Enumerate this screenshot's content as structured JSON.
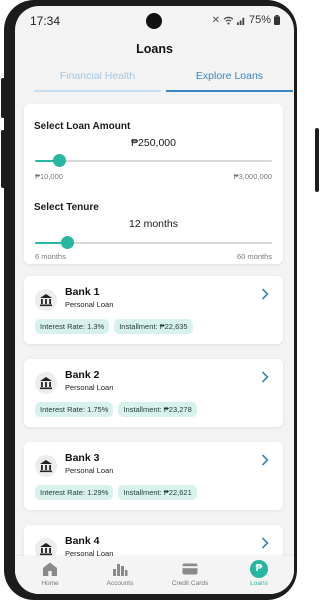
{
  "status_bar": {
    "time": "17:34",
    "battery": "75%"
  },
  "header": {
    "title": "Loans"
  },
  "tabs": [
    {
      "label": "Financial Health",
      "active": false
    },
    {
      "label": "Explore Loans",
      "active": true
    }
  ],
  "loan_amount": {
    "title": "Select Loan Amount",
    "value": "₱250,000",
    "min_label": "₱10,000",
    "max_label": "₱3,000,000",
    "slider_fraction": 0.1
  },
  "tenure": {
    "title": "Select Tenure",
    "value": "12 months",
    "min_label": "6 months",
    "max_label": "60 months",
    "slider_fraction": 0.135
  },
  "banks": [
    {
      "name": "Bank 1",
      "type": "Personal Loan",
      "interest": "Interest Rate: 1.3%",
      "installment": "Installment: ₱22,635"
    },
    {
      "name": "Bank 2",
      "type": "Personal Loan",
      "interest": "Interest Rate: 1.75%",
      "installment": "Installment: ₱23,278"
    },
    {
      "name": "Bank 3",
      "type": "Personal Loan",
      "interest": "Interest Rate: 1.29%",
      "installment": "Installment: ₱22,621"
    },
    {
      "name": "Bank 4",
      "type": "Personal Loan"
    }
  ],
  "bottom_nav": [
    {
      "label": "Home",
      "icon": "home-icon",
      "active": false
    },
    {
      "label": "Accounts",
      "icon": "bar-chart-icon",
      "active": false
    },
    {
      "label": "Credit Cards",
      "icon": "credit-card-icon",
      "active": false
    },
    {
      "label": "Loans",
      "icon": "peso-icon",
      "active": true
    }
  ],
  "colors": {
    "accent": "#27b7a1",
    "tab_active": "#3a86c0",
    "chip_bg": "#d9f1ec"
  }
}
